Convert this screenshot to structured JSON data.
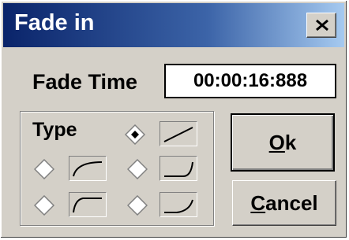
{
  "window": {
    "title": "Fade in",
    "close_icon": "close-x-icon"
  },
  "fade_time": {
    "label": "Fade Time",
    "value": "00:00:16:888"
  },
  "type_group": {
    "label": "Type",
    "selected": "linear",
    "options": [
      {
        "id": "linear",
        "curve_icon": "linear-curve-icon",
        "selected": true
      },
      {
        "id": "logarithmic-gentle",
        "curve_icon": "log-gentle-curve-icon",
        "selected": false
      },
      {
        "id": "exponential-late",
        "curve_icon": "exp-late-curve-icon",
        "selected": false
      },
      {
        "id": "logarithmic-steep",
        "curve_icon": "log-steep-curve-icon",
        "selected": false
      },
      {
        "id": "exponential-gentle",
        "curve_icon": "exp-gentle-curve-icon",
        "selected": false
      }
    ]
  },
  "buttons": {
    "ok": {
      "mnemonic": "O",
      "rest": "k"
    },
    "cancel": {
      "mnemonic": "C",
      "rest": "ancel"
    }
  }
}
